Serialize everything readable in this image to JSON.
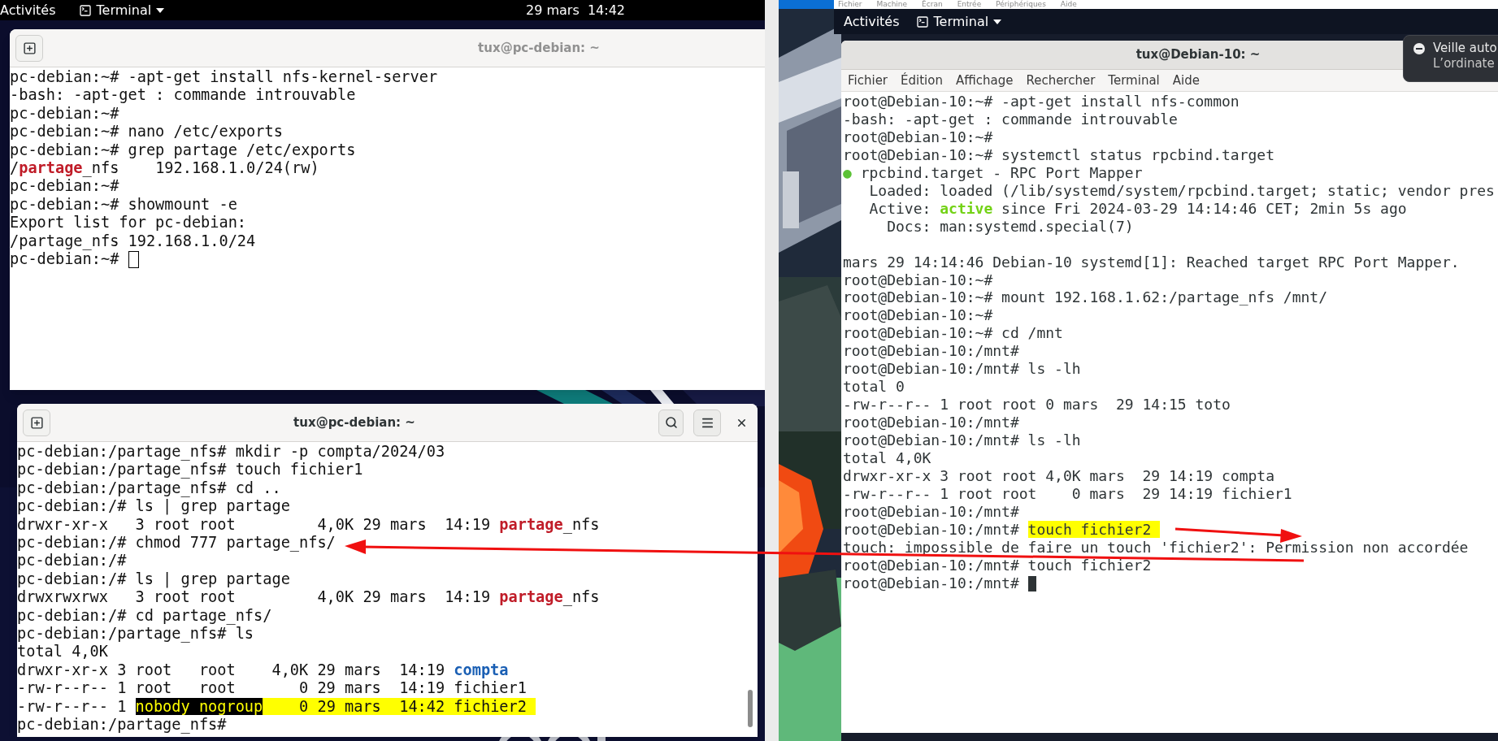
{
  "left_screen": {
    "top_bar": {
      "activities": "Activités",
      "app_menu": "Terminal",
      "clock": "29 mars  14:42"
    },
    "windows": [
      {
        "title": "tux@pc-debian: ~",
        "focused": false,
        "cursor_visible": true,
        "controls": [
          {
            "kind": "new_tab"
          }
        ],
        "lines": [
          {
            "text": "pc-debian:~# -apt-get install nfs-kernel-server"
          },
          {
            "text": "-bash: -apt-get : commande introuvable"
          },
          {
            "text": "pc-debian:~#"
          },
          {
            "text": "pc-debian:~# nano /etc/exports"
          },
          {
            "text": "pc-debian:~# grep partage /etc/exports"
          },
          {
            "segments": [
              {
                "text": "/",
                "kind": "plain"
              },
              {
                "text": "partage",
                "kind": "red_bold"
              },
              {
                "text": "_nfs    192.168.1.0/24(rw)",
                "kind": "plain"
              }
            ]
          },
          {
            "text": "pc-debian:~#"
          },
          {
            "text": "pc-debian:~# showmount -e"
          },
          {
            "text": "Export list for pc-debian:"
          },
          {
            "text": "/partage_nfs 192.168.1.0/24"
          },
          {
            "text": "pc-debian:~# "
          }
        ]
      },
      {
        "title": "tux@pc-debian: ~",
        "focused": true,
        "cursor_visible": false,
        "controls": [
          {
            "kind": "new_tab"
          },
          {
            "kind": "search"
          },
          {
            "kind": "menu"
          },
          {
            "kind": "close"
          }
        ],
        "lines": [
          {
            "text": "pc-debian:/partage_nfs# mkdir -p compta/2024/03"
          },
          {
            "text": "pc-debian:/partage_nfs# touch fichier1"
          },
          {
            "text": "pc-debian:/partage_nfs# cd .."
          },
          {
            "text": "pc-debian:/# ls | grep partage"
          },
          {
            "segments": [
              {
                "text": "drwxr-xr-x   3 root root         4,0K 29 mars  14:19 ",
                "kind": "plain"
              },
              {
                "text": "partage",
                "kind": "red_bold"
              },
              {
                "text": "_nfs",
                "kind": "plain"
              }
            ]
          },
          {
            "text": "pc-debian:/# chmod 777 partage_nfs/"
          },
          {
            "text": "pc-debian:/#"
          },
          {
            "text": "pc-debian:/# ls | grep partage"
          },
          {
            "segments": [
              {
                "text": "drwxrwxrwx   3 root root         4,0K 29 mars  14:19 ",
                "kind": "plain"
              },
              {
                "text": "partage",
                "kind": "red_bold"
              },
              {
                "text": "_nfs",
                "kind": "plain"
              }
            ]
          },
          {
            "text": "pc-debian:/# cd partage_nfs/"
          },
          {
            "text": "pc-debian:/partage_nfs# ls"
          },
          {
            "text": "total 4,0K"
          },
          {
            "segments": [
              {
                "text": "drwxr-xr-x 3 root   root    4,0K 29 mars  14:19 ",
                "kind": "plain"
              },
              {
                "text": "compta",
                "kind": "blue_bold"
              }
            ]
          },
          {
            "text": "-rw-r--r-- 1 root   root       0 29 mars  14:19 fichier1"
          },
          {
            "segments": [
              {
                "text": "-rw-r--r-- 1 ",
                "kind": "plain"
              },
              {
                "text": "nobody nogroup",
                "kind": "selection"
              },
              {
                "text": "    0 29 mars  14:42 fichier2 ",
                "kind": "highlight"
              }
            ]
          },
          {
            "text": "pc-debian:/partage_nfs#"
          }
        ]
      }
    ]
  },
  "right_screen": {
    "vbox_menu": [
      "Fichier",
      "Machine",
      "Écran",
      "Entrée",
      "Périphériques",
      "Aide"
    ],
    "top_bar": {
      "activities": "Activités",
      "app_menu": "Terminal"
    },
    "notification": {
      "title": "Veille auto",
      "body": "L’ordinate"
    },
    "window": {
      "title": "tux@Debian-10: ~",
      "focused": true,
      "cursor_visible": true,
      "menu": [
        "Fichier",
        "Édition",
        "Affichage",
        "Rechercher",
        "Terminal",
        "Aide"
      ],
      "blocks": [
        {
          "lines": [
            {
              "text": "root@Debian-10:~# -apt-get install nfs-common"
            },
            {
              "text": "-bash: -apt-get : commande introuvable"
            },
            {
              "text": "root@Debian-10:~#"
            },
            {
              "text": "root@Debian-10:~# systemctl status rpcbind.target"
            },
            {
              "segments": [
                {
                  "text": "●",
                  "kind": "green"
                },
                {
                  "text": " rpcbind.target - RPC Port Mapper",
                  "kind": "plain"
                }
              ]
            },
            {
              "text": "   Loaded: loaded (/lib/systemd/system/rpcbind.target; static; vendor pres"
            },
            {
              "segments": [
                {
                  "text": "   Active: ",
                  "kind": "plain"
                },
                {
                  "text": "active",
                  "kind": "green_bold"
                },
                {
                  "text": " since Fri 2024-03-29 14:14:46 CET; 2min 5s ago",
                  "kind": "plain"
                }
              ]
            },
            {
              "text": "     Docs: man:systemd.special(7)"
            }
          ]
        },
        {
          "lines": [
            {
              "text": "mars 29 14:14:46 Debian-10 systemd[1]: Reached target RPC Port Mapper."
            },
            {
              "text": "root@Debian-10:~#"
            },
            {
              "text": "root@Debian-10:~# mount 192.168.1.62:/partage_nfs /mnt/"
            },
            {
              "text": "root@Debian-10:~#"
            },
            {
              "text": "root@Debian-10:~# cd /mnt"
            },
            {
              "text": "root@Debian-10:/mnt#"
            },
            {
              "text": "root@Debian-10:/mnt# ls -lh"
            },
            {
              "text": "total 0"
            },
            {
              "text": "-rw-r--r-- 1 root root 0 mars  29 14:15 toto"
            },
            {
              "text": "root@Debian-10:/mnt#"
            },
            {
              "text": "root@Debian-10:/mnt# ls -lh"
            },
            {
              "text": "total 4,0K"
            },
            {
              "text": "drwxr-xr-x 3 root root 4,0K mars  29 14:19 compta"
            },
            {
              "text": "-rw-r--r-- 1 root root    0 mars  29 14:19 fichier1"
            },
            {
              "text": "root@Debian-10:/mnt#"
            },
            {
              "segments": [
                {
                  "text": "root@Debian-10:/mnt# ",
                  "kind": "plain"
                },
                {
                  "text": "touch fichier2 ",
                  "kind": "highlight"
                }
              ]
            },
            {
              "text": "touch: impossible de faire un touch 'fichier2': Permission non accordée"
            },
            {
              "text": "root@Debian-10:/mnt# touch fichier2"
            },
            {
              "text": "root@Debian-10:/mnt# "
            }
          ]
        }
      ]
    }
  }
}
